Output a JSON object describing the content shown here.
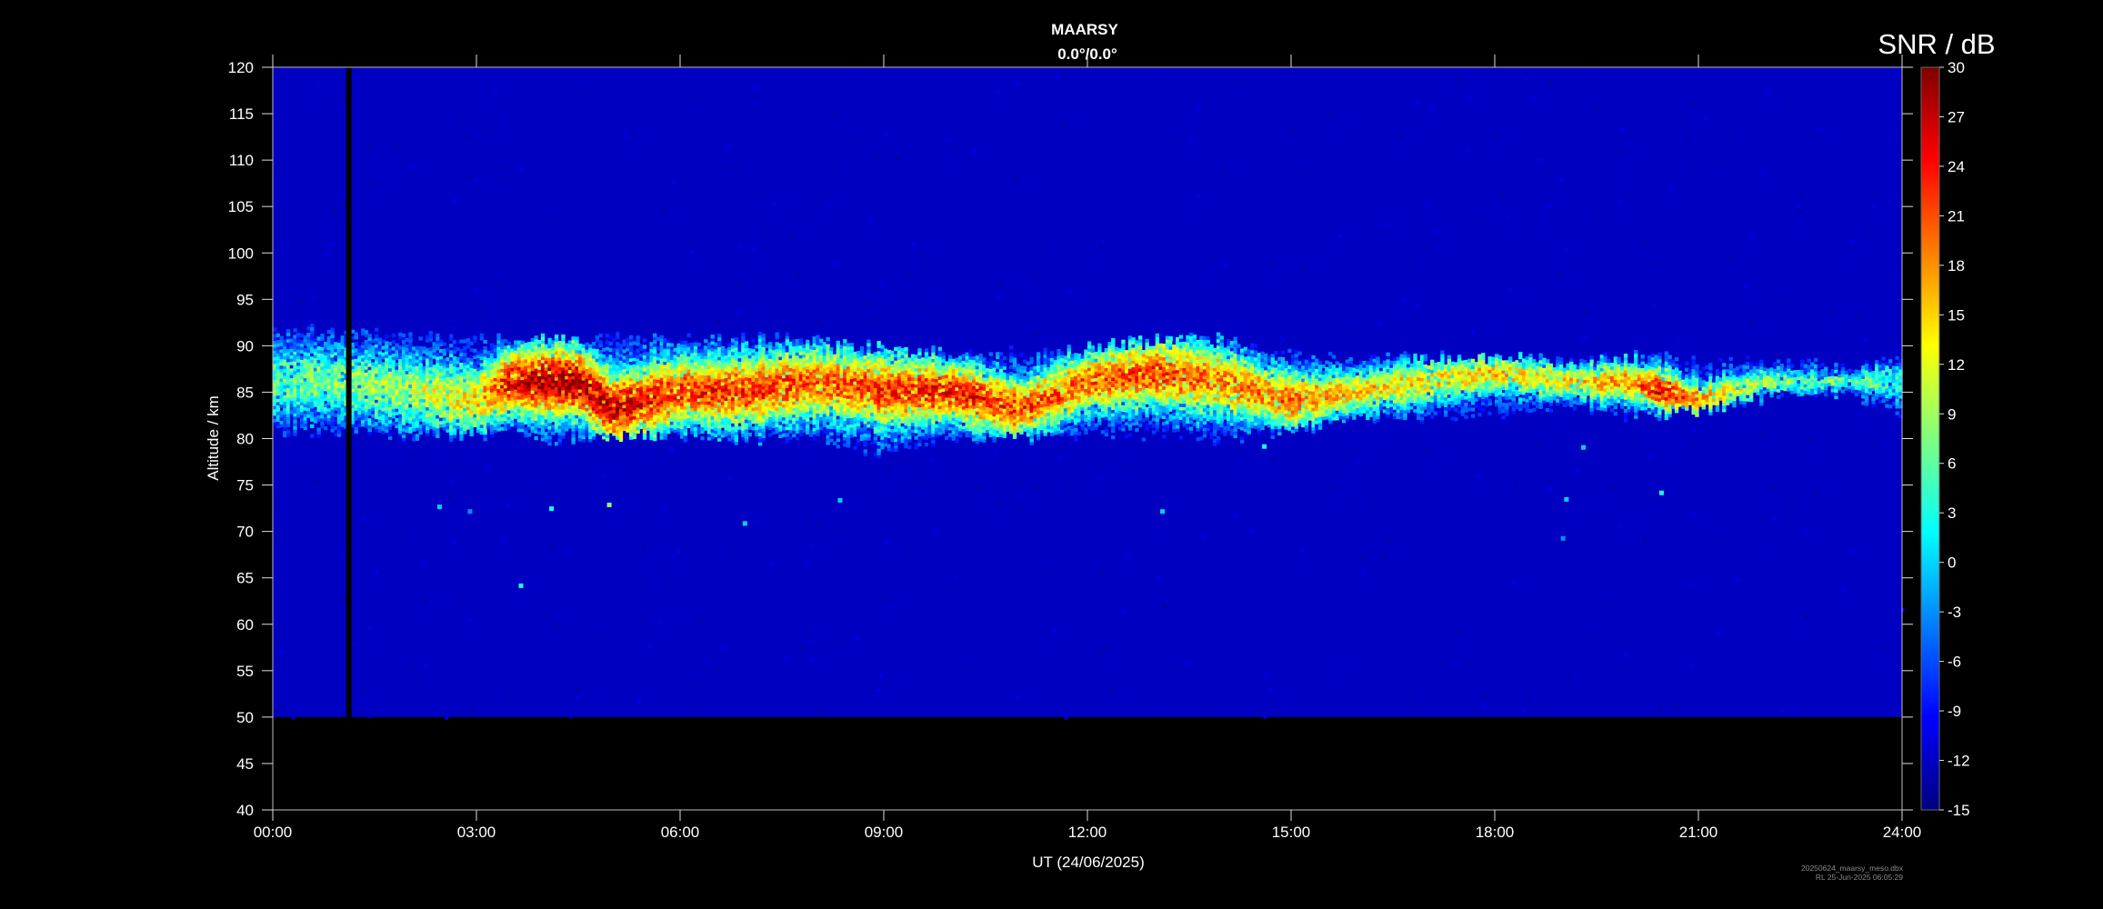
{
  "chart_data": {
    "type": "heatmap",
    "title": "MAARSY",
    "subtitle": "0.0°/0.0°",
    "xlabel": "UT (24/06/2025)",
    "ylabel": "Altitude / km",
    "x_tick_labels": [
      "00:00",
      "03:00",
      "06:00",
      "09:00",
      "12:00",
      "15:00",
      "18:00",
      "21:00",
      "24:00"
    ],
    "xlim_hours": [
      0,
      24
    ],
    "y_ticks": [
      40,
      45,
      50,
      55,
      60,
      65,
      70,
      75,
      80,
      85,
      90,
      95,
      100,
      105,
      110,
      115,
      120
    ],
    "ylim_km": [
      40,
      120
    ],
    "data_altitude_range_km": [
      50,
      120
    ],
    "colorbar": {
      "label": "SNR / dB",
      "ticks": [
        -15,
        -12,
        -9,
        -6,
        -3,
        0,
        3,
        6,
        9,
        12,
        15,
        18,
        21,
        24,
        27,
        30
      ],
      "range_db": [
        -15,
        30
      ],
      "colormap": "jet",
      "colors": [
        "#00007f",
        "#0000ff",
        "#007fff",
        "#00ffff",
        "#7fff7f",
        "#ffff00",
        "#ff7f00",
        "#ff0000",
        "#7f0000"
      ]
    },
    "background_snr_db": -12,
    "data_gap_hours": [
      1.08,
      1.16
    ],
    "echo_layer": [
      {
        "hour": 0.0,
        "bottom_km": 80.5,
        "top_km": 91.5,
        "peak_km": 86,
        "peak_snr_db": 6
      },
      {
        "hour": 1.0,
        "bottom_km": 81,
        "top_km": 91.5,
        "peak_km": 86,
        "peak_snr_db": 8
      },
      {
        "hour": 2.0,
        "bottom_km": 80.5,
        "top_km": 91,
        "peak_km": 85,
        "peak_snr_db": 10
      },
      {
        "hour": 3.0,
        "bottom_km": 80.5,
        "top_km": 90.5,
        "peak_km": 84,
        "peak_snr_db": 15
      },
      {
        "hour": 3.5,
        "bottom_km": 80.5,
        "top_km": 90.5,
        "peak_km": 86,
        "peak_snr_db": 25
      },
      {
        "hour": 4.0,
        "bottom_km": 80,
        "top_km": 90.5,
        "peak_km": 86,
        "peak_snr_db": 28
      },
      {
        "hour": 4.5,
        "bottom_km": 80,
        "top_km": 90.5,
        "peak_km": 86,
        "peak_snr_db": 29
      },
      {
        "hour": 5.0,
        "bottom_km": 80.5,
        "top_km": 91,
        "peak_km": 83,
        "peak_snr_db": 27
      },
      {
        "hour": 6.0,
        "bottom_km": 80.5,
        "top_km": 90.5,
        "peak_km": 85,
        "peak_snr_db": 22
      },
      {
        "hour": 7.0,
        "bottom_km": 80,
        "top_km": 90.5,
        "peak_km": 85,
        "peak_snr_db": 23
      },
      {
        "hour": 8.0,
        "bottom_km": 80,
        "top_km": 90.5,
        "peak_km": 86,
        "peak_snr_db": 20
      },
      {
        "hour": 9.0,
        "bottom_km": 78.5,
        "top_km": 89.5,
        "peak_km": 85,
        "peak_snr_db": 22
      },
      {
        "hour": 10.0,
        "bottom_km": 80,
        "top_km": 89,
        "peak_km": 85,
        "peak_snr_db": 24
      },
      {
        "hour": 11.0,
        "bottom_km": 80,
        "top_km": 89,
        "peak_km": 83,
        "peak_snr_db": 22
      },
      {
        "hour": 12.0,
        "bottom_km": 80.5,
        "top_km": 89.5,
        "peak_km": 86,
        "peak_snr_db": 20
      },
      {
        "hour": 13.0,
        "bottom_km": 80.5,
        "top_km": 90.5,
        "peak_km": 87,
        "peak_snr_db": 22
      },
      {
        "hour": 14.0,
        "bottom_km": 80,
        "top_km": 90.5,
        "peak_km": 86,
        "peak_snr_db": 18
      },
      {
        "hour": 15.0,
        "bottom_km": 81,
        "top_km": 89,
        "peak_km": 84,
        "peak_snr_db": 20
      },
      {
        "hour": 16.0,
        "bottom_km": 82,
        "top_km": 88.5,
        "peak_km": 85,
        "peak_snr_db": 16
      },
      {
        "hour": 17.0,
        "bottom_km": 82,
        "top_km": 88.5,
        "peak_km": 86,
        "peak_snr_db": 14
      },
      {
        "hour": 18.0,
        "bottom_km": 82.5,
        "top_km": 88.5,
        "peak_km": 87,
        "peak_snr_db": 15
      },
      {
        "hour": 19.0,
        "bottom_km": 83,
        "top_km": 88.5,
        "peak_km": 86,
        "peak_snr_db": 14
      },
      {
        "hour": 20.0,
        "bottom_km": 82.5,
        "top_km": 88.5,
        "peak_km": 86,
        "peak_snr_db": 18
      },
      {
        "hour": 20.5,
        "bottom_km": 82.5,
        "top_km": 88.5,
        "peak_km": 85,
        "peak_snr_db": 26
      },
      {
        "hour": 21.0,
        "bottom_km": 83,
        "top_km": 88,
        "peak_km": 84,
        "peak_snr_db": 18
      },
      {
        "hour": 22.0,
        "bottom_km": 84.5,
        "top_km": 88.5,
        "peak_km": 86,
        "peak_snr_db": 8
      },
      {
        "hour": 23.0,
        "bottom_km": 85,
        "top_km": 88,
        "peak_km": 86,
        "peak_snr_db": 6
      },
      {
        "hour": 24.0,
        "bottom_km": 82,
        "top_km": 88,
        "peak_km": 86,
        "peak_snr_db": 4
      }
    ],
    "isolated_echoes": [
      {
        "hour": 2.45,
        "altitude_km": 72.7,
        "snr_db": 0
      },
      {
        "hour": 2.9,
        "altitude_km": 72.2,
        "snr_db": -3
      },
      {
        "hour": 4.1,
        "altitude_km": 72.5,
        "snr_db": 3
      },
      {
        "hour": 4.95,
        "altitude_km": 72.9,
        "snr_db": 8
      },
      {
        "hour": 3.65,
        "altitude_km": 64.2,
        "snr_db": 3
      },
      {
        "hour": 6.95,
        "altitude_km": 70.9,
        "snr_db": 0
      },
      {
        "hour": 8.35,
        "altitude_km": 73.4,
        "snr_db": 0
      },
      {
        "hour": 13.1,
        "altitude_km": 72.2,
        "snr_db": 0
      },
      {
        "hour": 19.05,
        "altitude_km": 73.5,
        "snr_db": 0
      },
      {
        "hour": 19.0,
        "altitude_km": 69.3,
        "snr_db": -3
      },
      {
        "hour": 20.45,
        "altitude_km": 74.2,
        "snr_db": 3
      },
      {
        "hour": 19.3,
        "altitude_km": 79.1,
        "snr_db": 0
      },
      {
        "hour": 14.6,
        "altitude_km": 79.2,
        "snr_db": 3
      }
    ]
  },
  "footer": {
    "file_label": "20250624_maarsy_meso.dbx",
    "timestamp_label": "RL 25-Jun-2025 06:05:29"
  }
}
